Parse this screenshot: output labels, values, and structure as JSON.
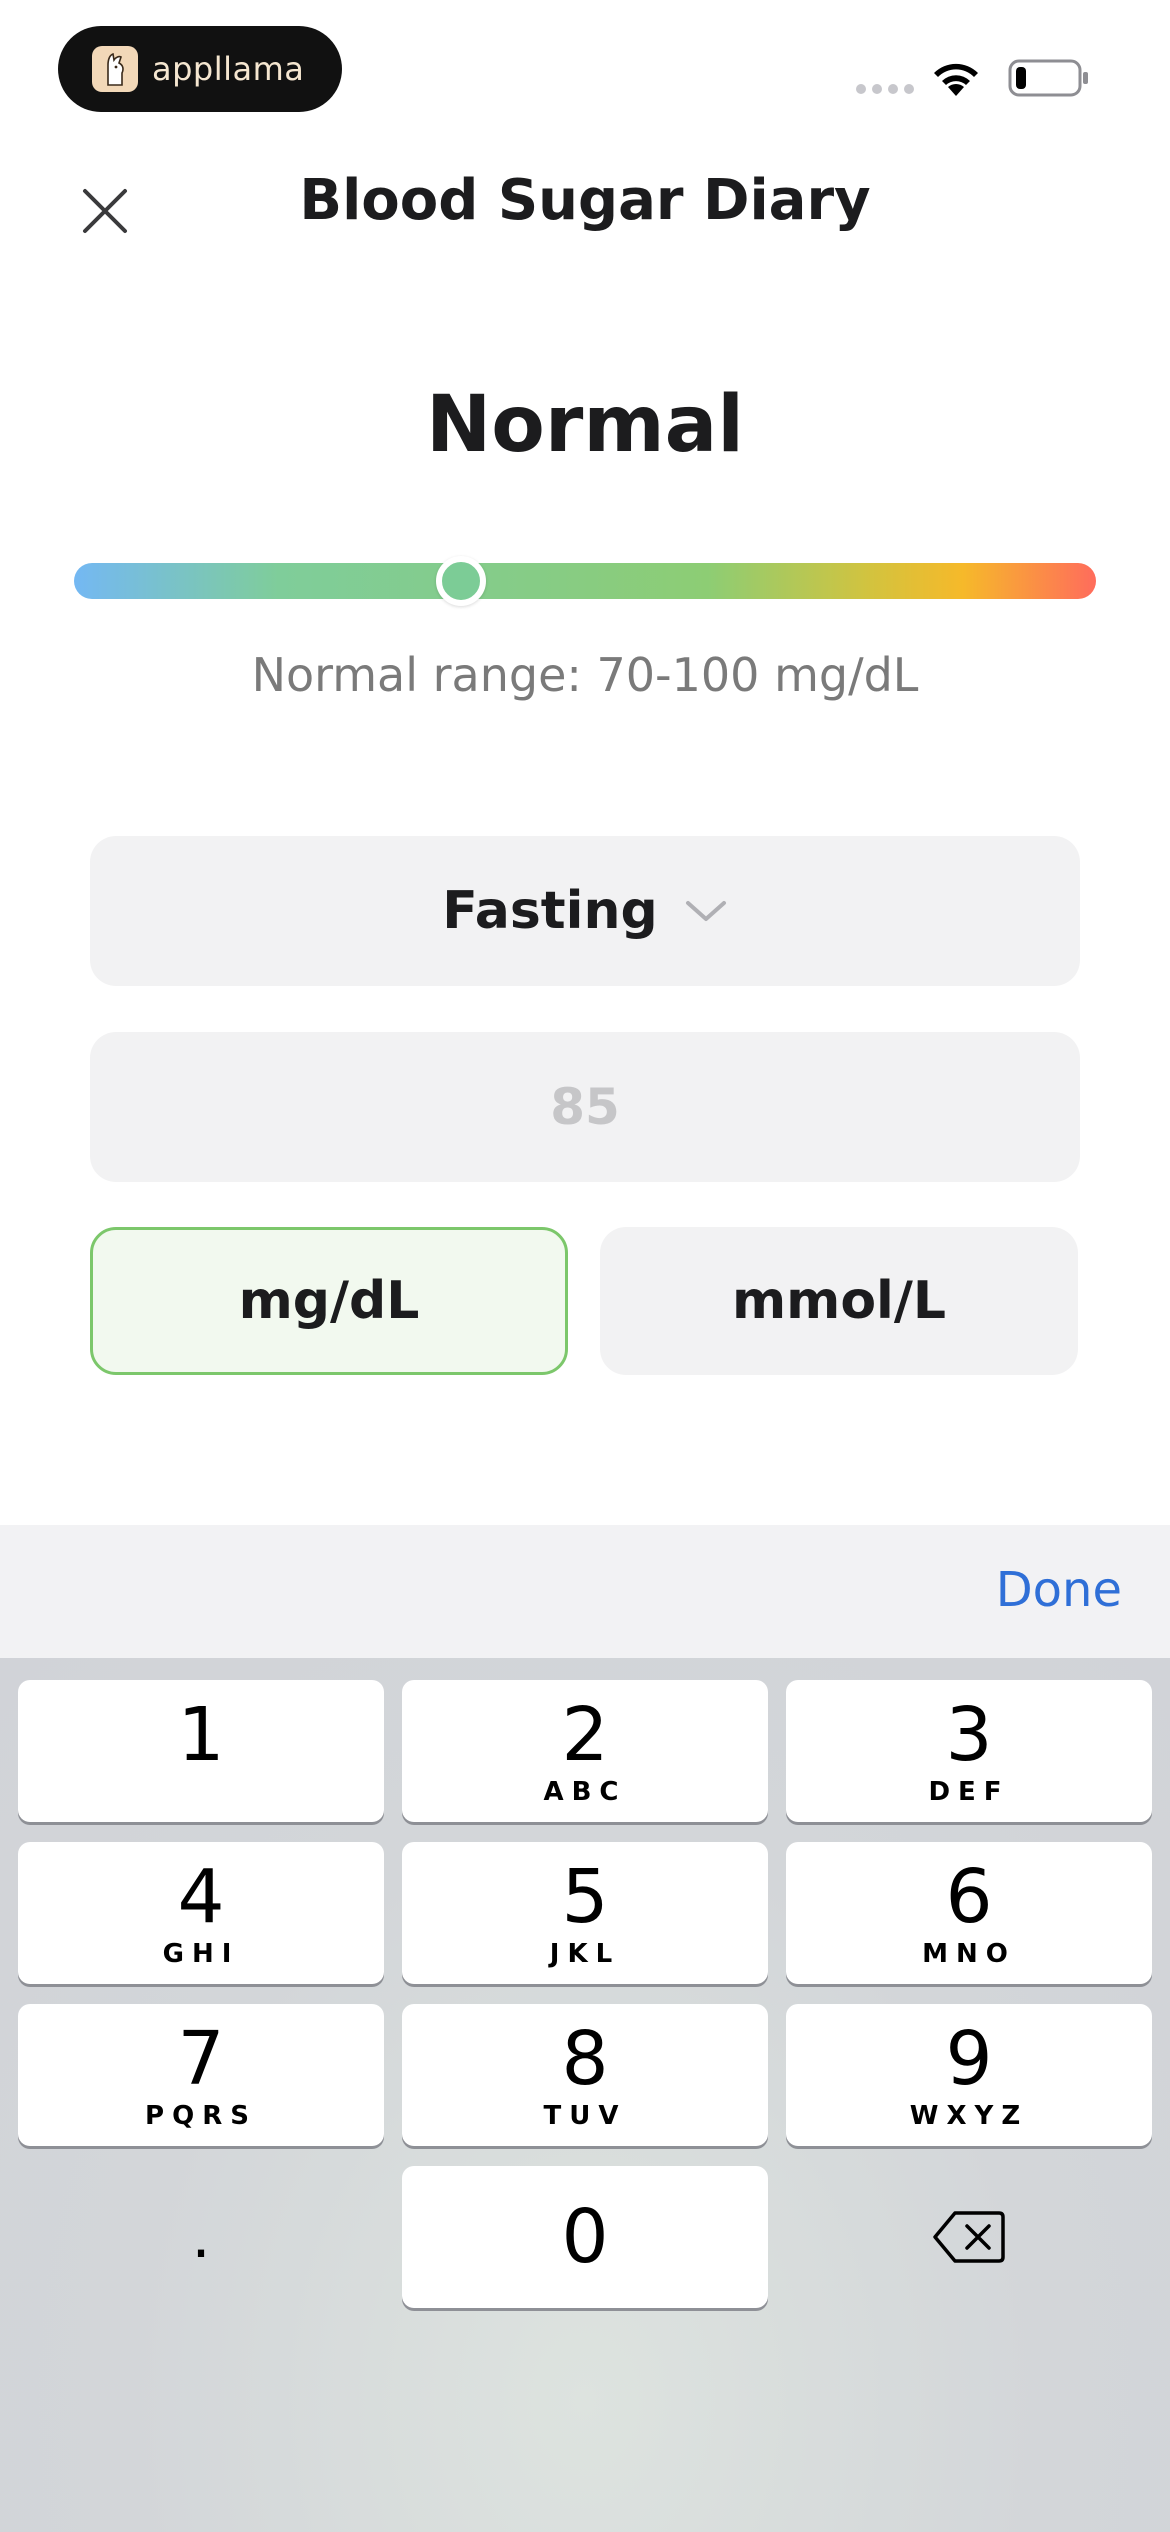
{
  "status_bar": {
    "brand_name": "appllama"
  },
  "header": {
    "title": "Blood Sugar Diary",
    "close_icon": "close-icon"
  },
  "reading": {
    "status_label": "Normal",
    "range_text": "Normal range: 70-100 mg/dL",
    "range_colors": [
      "#74b8f3",
      "#7fcd9a",
      "#8dcd74",
      "#f6b92a",
      "#ff6c5c"
    ],
    "indicator_color": "#7ccc96"
  },
  "form": {
    "meal_type": "Fasting",
    "value_placeholder": "85",
    "value": "",
    "units": [
      {
        "label": "mg/dL",
        "selected": true
      },
      {
        "label": "mmol/L",
        "selected": false
      }
    ],
    "accent_color": "#7cc76b"
  },
  "keyboard": {
    "done_label": "Done",
    "keys": [
      {
        "num": "1",
        "letters": ""
      },
      {
        "num": "2",
        "letters": "ABC"
      },
      {
        "num": "3",
        "letters": "DEF"
      },
      {
        "num": "4",
        "letters": "GHI"
      },
      {
        "num": "5",
        "letters": "JKL"
      },
      {
        "num": "6",
        "letters": "MNO"
      },
      {
        "num": "7",
        "letters": "PQRS"
      },
      {
        "num": "8",
        "letters": "TUV"
      },
      {
        "num": "9",
        "letters": "WXYZ"
      },
      {
        "num": "0",
        "letters": ""
      }
    ],
    "decimal_label": ".",
    "delete_icon": "backspace-icon"
  }
}
